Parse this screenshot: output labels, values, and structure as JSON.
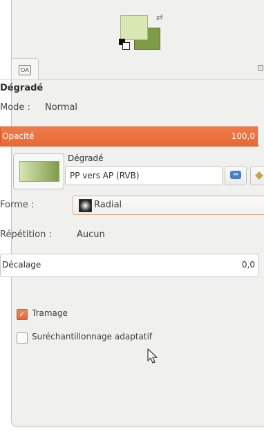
{
  "swatches": {
    "fg_color": "#d9e7b3",
    "bg_color": "#7e9b48",
    "swap_icon": "swap-icon",
    "default_icon": "default-colors-icon"
  },
  "tab": {
    "icon": "tool-options-icon",
    "icon_text": "ꝹA",
    "menu_icon": "⊡"
  },
  "title": "Dégradé",
  "mode": {
    "label": "Mode :",
    "value": "Normal"
  },
  "opacity": {
    "label": "Opacité",
    "value": "100,0",
    "fill_fraction": 1.0
  },
  "gradient": {
    "label": "Dégradé",
    "name": "PP vers AP (RVB)",
    "preview_start": "#d8e6b1",
    "preview_end": "#7f9c49",
    "reverse_icon": "reverse-gradient-icon",
    "edit_icon": "edit-gradient-icon"
  },
  "shape": {
    "label": "Forme :",
    "value": "Radial",
    "icon": "radial-icon"
  },
  "repeat": {
    "label": "Répétition :",
    "value": "Aucun"
  },
  "offset": {
    "label": "Décalage",
    "value": "0,0"
  },
  "checks": [
    {
      "label": "Tramage",
      "checked": true
    },
    {
      "label": "Suréchantillonnage adaptatif",
      "checked": false
    }
  ],
  "accent_color": "#e86a35"
}
